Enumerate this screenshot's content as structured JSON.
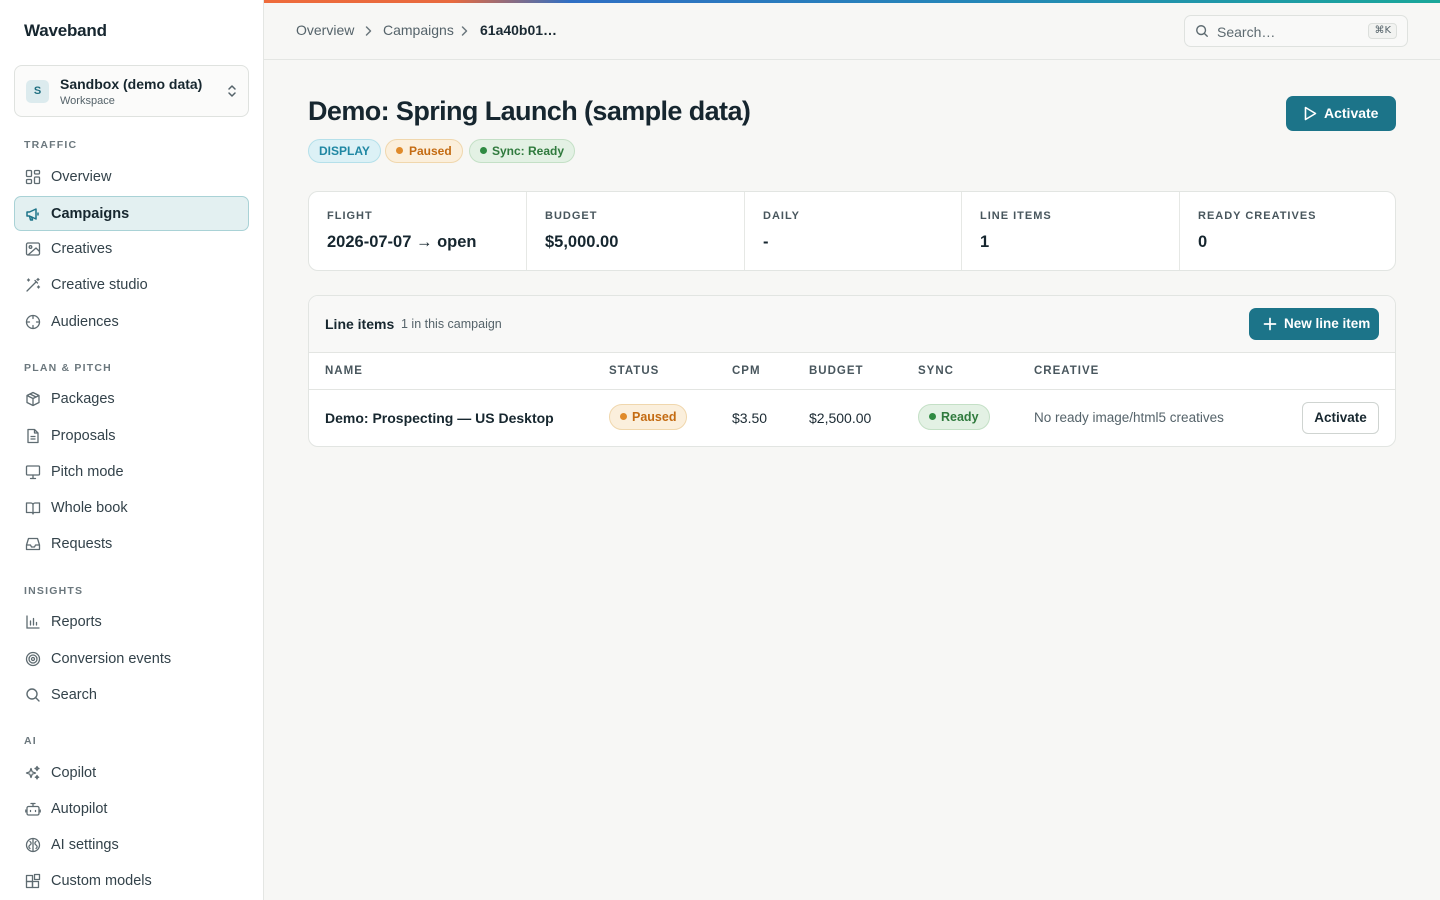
{
  "app": {
    "brand": "Waveband"
  },
  "workspace": {
    "avatar": "S",
    "name": "Sandbox (demo data)",
    "sub": "Workspace"
  },
  "sidebar": {
    "sections": [
      {
        "label": "TRAFFIC",
        "items": [
          {
            "label": "Overview",
            "icon": "grid-icon"
          },
          {
            "label": "Campaigns",
            "icon": "megaphone-icon",
            "active": true
          },
          {
            "label": "Creatives",
            "icon": "image-icon"
          },
          {
            "label": "Creative studio",
            "icon": "wand-icon"
          },
          {
            "label": "Audiences",
            "icon": "target-icon"
          }
        ]
      },
      {
        "label": "PLAN & PITCH",
        "items": [
          {
            "label": "Packages",
            "icon": "package-icon"
          },
          {
            "label": "Proposals",
            "icon": "document-icon"
          },
          {
            "label": "Pitch mode",
            "icon": "presentation-icon"
          },
          {
            "label": "Whole book",
            "icon": "book-icon"
          },
          {
            "label": "Requests",
            "icon": "inbox-icon"
          }
        ]
      },
      {
        "label": "INSIGHTS",
        "items": [
          {
            "label": "Reports",
            "icon": "bar-chart-icon"
          },
          {
            "label": "Conversion events",
            "icon": "crosshair-icon"
          },
          {
            "label": "Search",
            "icon": "search-icon"
          }
        ]
      },
      {
        "label": "AI",
        "items": [
          {
            "label": "Copilot",
            "icon": "sparkles-icon"
          },
          {
            "label": "Autopilot",
            "icon": "bot-icon"
          },
          {
            "label": "AI settings",
            "icon": "brain-icon"
          },
          {
            "label": "Custom models",
            "icon": "blocks-icon"
          }
        ]
      }
    ]
  },
  "topbar": {
    "breadcrumbs": [
      "Overview",
      "Campaigns",
      "61a40b01…"
    ],
    "search_placeholder": "Search…",
    "search_shortcut": "⌘K"
  },
  "campaign": {
    "title": "Demo: Spring Launch (sample data)",
    "activate_label": "Activate",
    "badges": {
      "type": "DISPLAY",
      "status": "Paused",
      "sync": "Sync: Ready"
    },
    "stats": [
      {
        "label": "FLIGHT",
        "value": "2026-07-07 → open"
      },
      {
        "label": "BUDGET",
        "value": "$5,000.00"
      },
      {
        "label": "DAILY",
        "value": "-"
      },
      {
        "label": "LINE ITEMS",
        "value": "1"
      },
      {
        "label": "READY CREATIVES",
        "value": "0"
      }
    ]
  },
  "line_items": {
    "title": "Line items",
    "subtitle": "1 in this campaign",
    "new_label": "New line item",
    "columns": [
      "NAME",
      "STATUS",
      "CPM",
      "BUDGET",
      "SYNC",
      "CREATIVE"
    ],
    "rows": [
      {
        "name": "Demo: Prospecting — US Desktop",
        "status": "Paused",
        "cpm": "$3.50",
        "budget": "$2,500.00",
        "sync": "Ready",
        "creative": "No ready image/html5 creatives",
        "action": "Activate"
      }
    ]
  },
  "colors": {
    "accent": "#1c7489",
    "paused": "#c46b12",
    "ready": "#2f7a3d",
    "display": "#1f87a3"
  }
}
